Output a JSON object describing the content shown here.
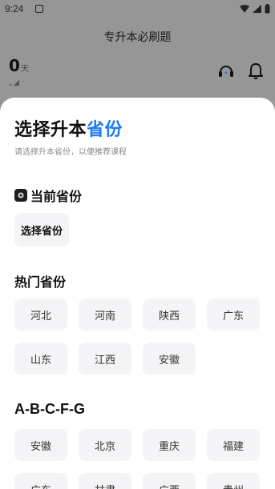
{
  "statusbar": {
    "time": "9:24"
  },
  "background": {
    "title": "专升本必刷题",
    "days_value": "0",
    "days_unit": "天"
  },
  "sheet": {
    "title_main": "选择升本",
    "title_accent": "省份",
    "subtitle": "请选择升本省份，以便推荐课程",
    "current_section": {
      "title": "当前省份",
      "chip": "选择省份"
    },
    "hot_section": {
      "title": "热门省份",
      "items": [
        "河北",
        "河南",
        "陕西",
        "广东",
        "山东",
        "江西",
        "安徽"
      ]
    },
    "alpha_section": {
      "title": "A-B-C-F-G",
      "items": [
        "安徽",
        "北京",
        "重庆",
        "福建",
        "广东",
        "甘肃",
        "广西",
        "贵州"
      ]
    }
  },
  "colors": {
    "accent": "#1e7cf2",
    "chip_bg": "#f4f4f6"
  }
}
